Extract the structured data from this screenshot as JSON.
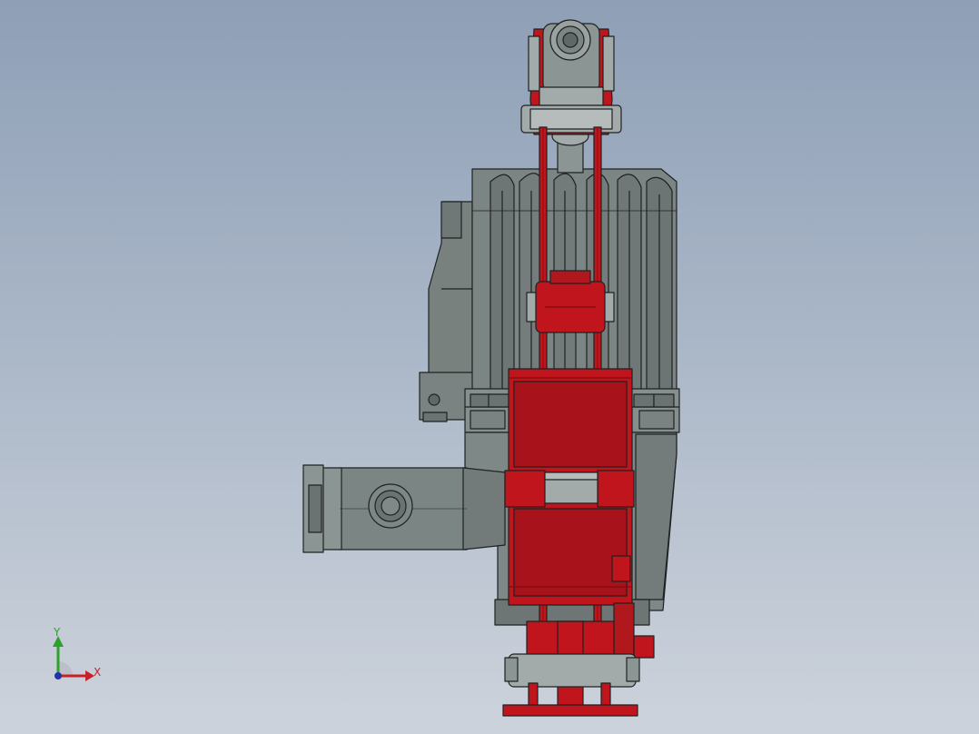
{
  "triad": {
    "y_label": "Y",
    "x_label": "X"
  },
  "colors": {
    "background_top": "#8e9fb6",
    "background_bottom": "#cdd3dc",
    "motor_gray": "#7b8583",
    "motor_shadow": "#5f6866",
    "metal_light": "#a3abaa",
    "frame_red": "#c0151c",
    "frame_red_dark": "#7d0c10",
    "outline": "#1f2222",
    "axis_x": "#c8202a",
    "axis_y": "#2ea02e",
    "axis_z": "#2233aa"
  }
}
